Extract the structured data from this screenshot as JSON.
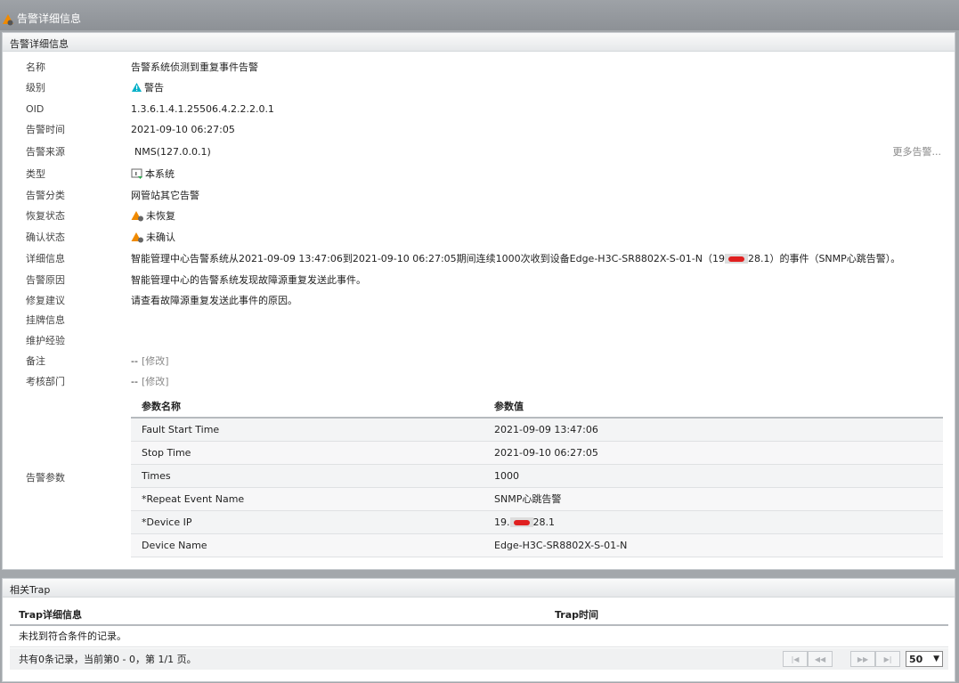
{
  "window": {
    "title": "告警详细信息"
  },
  "detail_panel": {
    "header": "告警详细信息",
    "more_link": "更多告警...",
    "edit_link": "[修改]",
    "fields": [
      {
        "label": "名称",
        "value": "告警系统侦测到重复事件告警"
      },
      {
        "label": "级别",
        "value": "警告",
        "icon": "warning-triangle-icon",
        "icon_color": "#00b0c8"
      },
      {
        "label": "OID",
        "value": "1.3.6.1.4.1.25506.4.2.2.2.0.1"
      },
      {
        "label": "告警时间",
        "value": "2021-09-10 06:27:05"
      },
      {
        "label": "告警来源",
        "value": "NMS(127.0.0.1)"
      },
      {
        "label": "类型",
        "value": "本系统",
        "icon": "system-monitor-icon"
      },
      {
        "label": "告警分类",
        "value": "网管站其它告警"
      },
      {
        "label": "恢复状态",
        "value": "未恢复",
        "icon": "alert-status-icon",
        "icon_color": "#f08a00"
      },
      {
        "label": "确认状态",
        "value": "未确认",
        "icon": "alert-status-icon",
        "icon_color": "#f08a00"
      },
      {
        "label": "详细信息",
        "value_pre": "智能管理中心告警系统从2021-09-09 13:47:06到2021-09-10 06:27:05期间连续1000次收到设备Edge-H3C-SR8802X-S-01-N（19",
        "value_post": "28.1）的事件（SNMP心跳告警）。"
      },
      {
        "label": "告警原因",
        "value": "智能管理中心的告警系统发现故障源重复发送此事件。"
      },
      {
        "label": "修复建议",
        "value": "请查看故障源重复发送此事件的原因。"
      },
      {
        "label": "挂牌信息",
        "value": ""
      },
      {
        "label": "维护经验",
        "value": ""
      },
      {
        "label": "备注",
        "value": "--"
      },
      {
        "label": "考核部门",
        "value": "--"
      }
    ],
    "params": {
      "label": "告警参数",
      "headers": [
        "参数名称",
        "参数值"
      ],
      "rows": [
        {
          "name": "Fault Start Time",
          "value": "2021-09-09 13:47:06"
        },
        {
          "name": "Stop Time",
          "value": "2021-09-10 06:27:05"
        },
        {
          "name": "Times",
          "value": "1000"
        },
        {
          "name": "*Repeat Event Name",
          "value": "SNMP心跳告警"
        },
        {
          "name": "*Device IP",
          "value_pre": "19.",
          "value_post": "28.1"
        },
        {
          "name": "Device Name",
          "value": "Edge-H3C-SR8802X-S-01-N"
        }
      ]
    }
  },
  "trap_panel": {
    "header": "相关Trap",
    "headers": [
      "Trap详细信息",
      "Trap时间"
    ],
    "empty_text": "未找到符合条件的记录。",
    "summary": "共有0条记录，当前第0 - 0，第 1/1 页。",
    "page_size": "50",
    "pager_buttons": [
      "first-page-icon",
      "prev-page-icon",
      "next-page-icon",
      "last-page-icon"
    ]
  }
}
